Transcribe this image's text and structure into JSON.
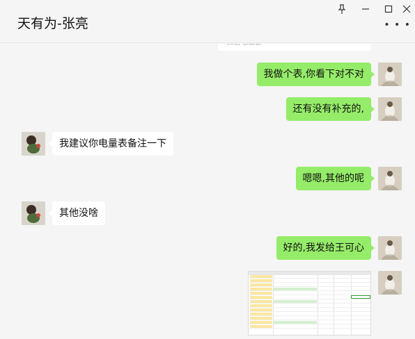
{
  "window": {
    "title": "天有为-张亮",
    "controls": {
      "pin_icon": "pin-icon",
      "minimize_icon": "minimize-icon",
      "maximize_icon": "maximize-icon",
      "close_icon": "close-icon",
      "more_icon": "more-icon"
    }
  },
  "quoted_text": "微信电脑版",
  "messages": [
    {
      "side": "self",
      "text": "我做个表,你看下对不对"
    },
    {
      "side": "self",
      "text": "还有没有补充的,"
    },
    {
      "side": "other",
      "text": "我建议你电量表备注一下"
    },
    {
      "side": "self",
      "text": "嗯嗯,其他的呢"
    },
    {
      "side": "other",
      "text": "其他没啥"
    },
    {
      "side": "self",
      "text": "好的,我发给王可心"
    },
    {
      "side": "self",
      "type": "image",
      "description": "spreadsheet"
    }
  ],
  "colors": {
    "self_bubble": "#95ec69",
    "other_bubble": "#ffffff",
    "background": "#f5f5f5"
  }
}
